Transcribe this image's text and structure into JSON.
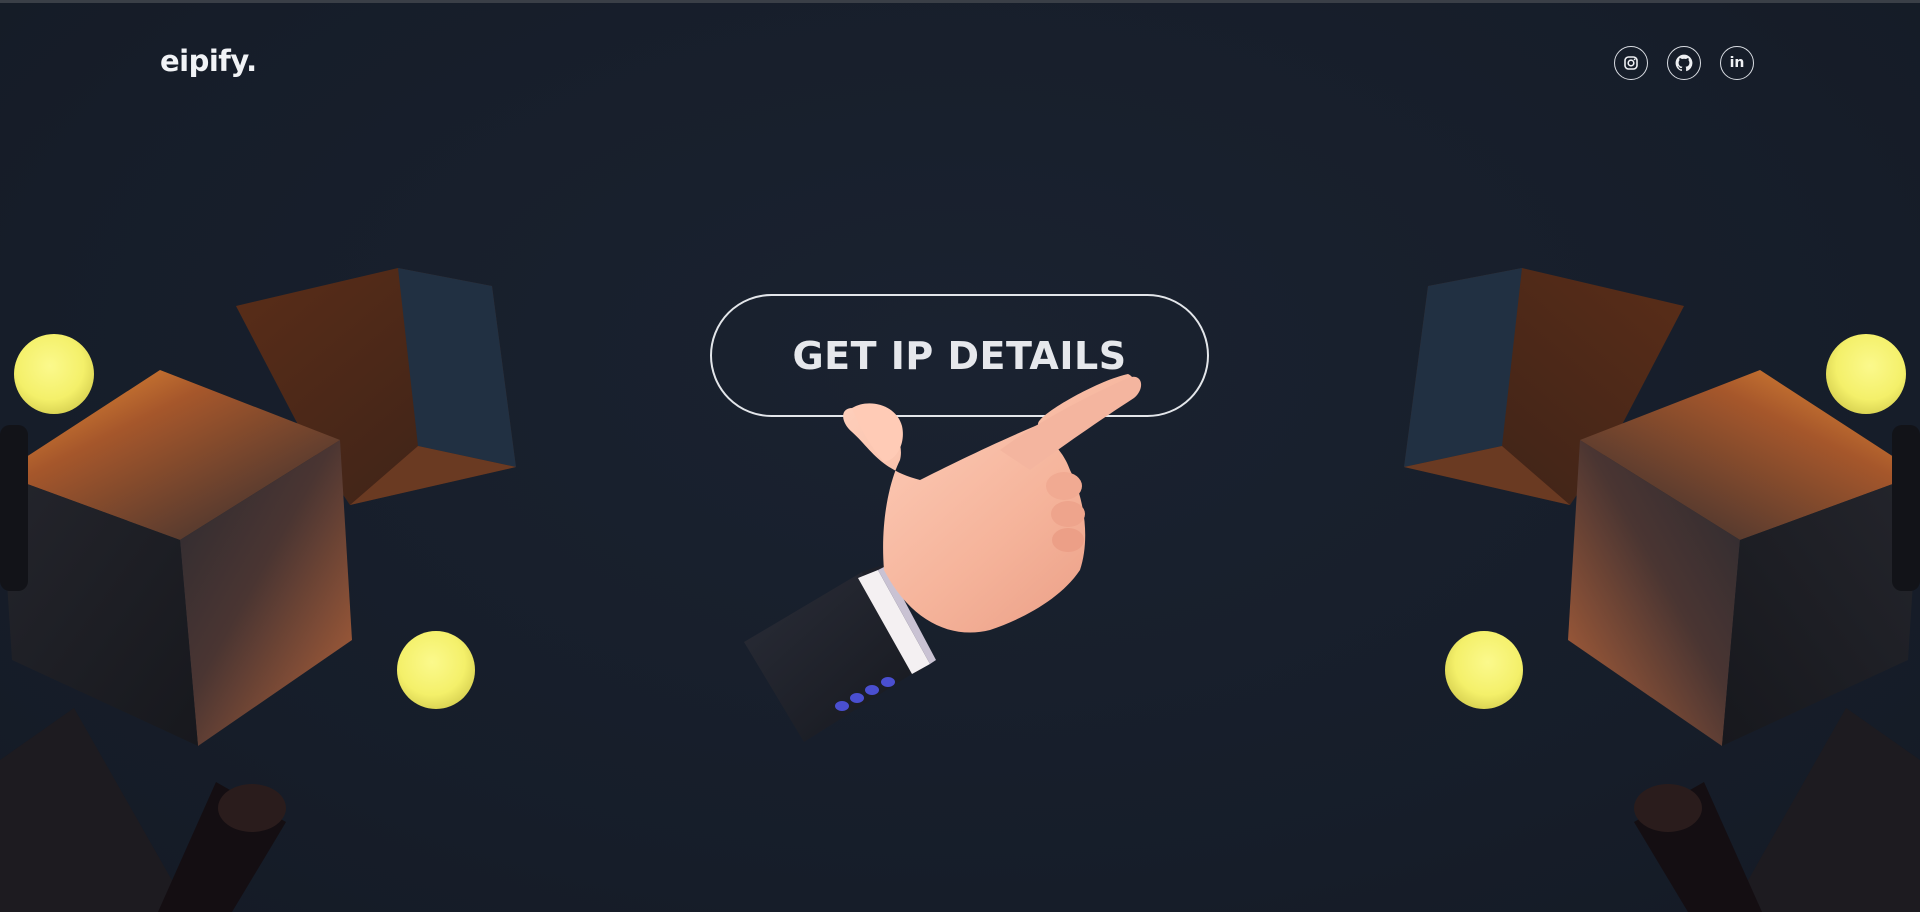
{
  "header": {
    "logo": "eipify."
  },
  "socials": [
    {
      "name": "instagram",
      "icon": "instagram-icon"
    },
    {
      "name": "github",
      "icon": "github-icon"
    },
    {
      "name": "linkedin",
      "icon": "linkedin-icon",
      "text": "in"
    }
  ],
  "hero": {
    "cta_label": "GET IP DETAILS"
  },
  "colors": {
    "background": "#18202d",
    "accent_yellow": "#f5f06a",
    "cube_orange": "#c0642c",
    "text": "#e6e8ec"
  }
}
